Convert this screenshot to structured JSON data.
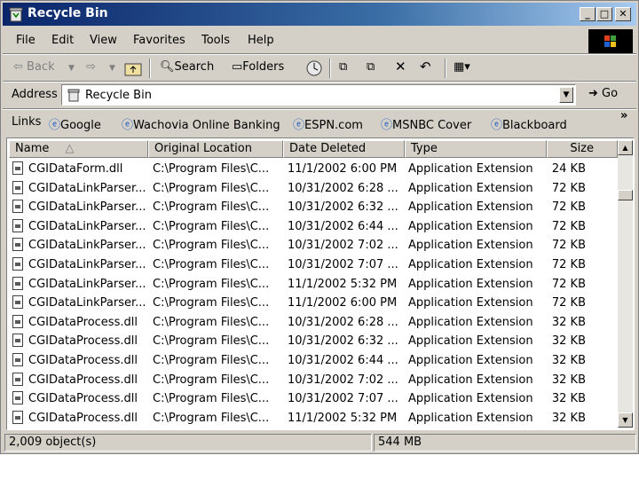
{
  "window": {
    "title": "Recycle Bin"
  },
  "title_buttons": {
    "minimize": "_",
    "maximize": "□",
    "close": "✕"
  },
  "menu": [
    "File",
    "Edit",
    "View",
    "Favorites",
    "Tools",
    "Help"
  ],
  "toolbar": {
    "back": "Back",
    "search": "Search",
    "folders": "Folders"
  },
  "address": {
    "label": "Address",
    "value": "Recycle Bin",
    "go": "Go"
  },
  "links": {
    "label": "Links",
    "items": [
      "Google",
      "Wachovia Online Banking",
      "ESPN.com",
      "MSNBC Cover",
      "Blackboard"
    ],
    "more": "»"
  },
  "columns": [
    "Name",
    "Original Location",
    "Date Deleted",
    "Type",
    "Size"
  ],
  "files": [
    {
      "name": "CGIDataForm.dll",
      "location": "C:\\Program Files\\C...",
      "date": "11/1/2002 6:00 PM",
      "type": "Application Extension",
      "size": "24 KB"
    },
    {
      "name": "CGIDataLinkParser...",
      "location": "C:\\Program Files\\C...",
      "date": "10/31/2002 6:28 ...",
      "type": "Application Extension",
      "size": "72 KB"
    },
    {
      "name": "CGIDataLinkParser...",
      "location": "C:\\Program Files\\C...",
      "date": "10/31/2002 6:32 ...",
      "type": "Application Extension",
      "size": "72 KB"
    },
    {
      "name": "CGIDataLinkParser...",
      "location": "C:\\Program Files\\C...",
      "date": "10/31/2002 6:44 ...",
      "type": "Application Extension",
      "size": "72 KB"
    },
    {
      "name": "CGIDataLinkParser...",
      "location": "C:\\Program Files\\C...",
      "date": "10/31/2002 7:02 ...",
      "type": "Application Extension",
      "size": "72 KB"
    },
    {
      "name": "CGIDataLinkParser...",
      "location": "C:\\Program Files\\C...",
      "date": "10/31/2002 7:07 ...",
      "type": "Application Extension",
      "size": "72 KB"
    },
    {
      "name": "CGIDataLinkParser...",
      "location": "C:\\Program Files\\C...",
      "date": "11/1/2002 5:32 PM",
      "type": "Application Extension",
      "size": "72 KB"
    },
    {
      "name": "CGIDataLinkParser...",
      "location": "C:\\Program Files\\C...",
      "date": "11/1/2002 6:00 PM",
      "type": "Application Extension",
      "size": "72 KB"
    },
    {
      "name": "CGIDataProcess.dll",
      "location": "C:\\Program Files\\C...",
      "date": "10/31/2002 6:28 ...",
      "type": "Application Extension",
      "size": "32 KB"
    },
    {
      "name": "CGIDataProcess.dll",
      "location": "C:\\Program Files\\C...",
      "date": "10/31/2002 6:32 ...",
      "type": "Application Extension",
      "size": "32 KB"
    },
    {
      "name": "CGIDataProcess.dll",
      "location": "C:\\Program Files\\C...",
      "date": "10/31/2002 6:44 ...",
      "type": "Application Extension",
      "size": "32 KB"
    },
    {
      "name": "CGIDataProcess.dll",
      "location": "C:\\Program Files\\C...",
      "date": "10/31/2002 7:02 ...",
      "type": "Application Extension",
      "size": "32 KB"
    },
    {
      "name": "CGIDataProcess.dll",
      "location": "C:\\Program Files\\C...",
      "date": "10/31/2002 7:07 ...",
      "type": "Application Extension",
      "size": "32 KB"
    },
    {
      "name": "CGIDataProcess.dll",
      "location": "C:\\Program Files\\C...",
      "date": "11/1/2002 5:32 PM",
      "type": "Application Extension",
      "size": "32 KB"
    }
  ],
  "status": {
    "objects": "2,009 object(s)",
    "size": "544 MB"
  }
}
